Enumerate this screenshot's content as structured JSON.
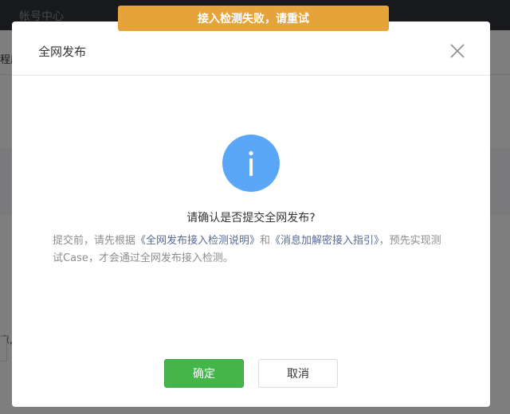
{
  "background": {
    "topbar_title": "帐号中心",
    "subbar_text": "程序",
    "grey_text": "意,"
  },
  "toast": {
    "message": "接入检测失败，请重试",
    "color": "#e5a339"
  },
  "dialog": {
    "title": "全网发布",
    "close_icon": "close-icon",
    "status_icon": "info-icon",
    "question": "请确认是否提交全网发布?",
    "description": {
      "part1": "提交前，请先根据",
      "link1": "《全网发布接入检测说明》",
      "part2": "和",
      "link2": "《消息加解密接入指引》",
      "part3": "，预先实现测试Case，才会通过全网发布接入检测。"
    },
    "confirm_label": "确定",
    "cancel_label": "取消"
  },
  "colors": {
    "primary_button": "#44b549",
    "info_icon": "#5ba7f7",
    "link": "#576b95"
  }
}
